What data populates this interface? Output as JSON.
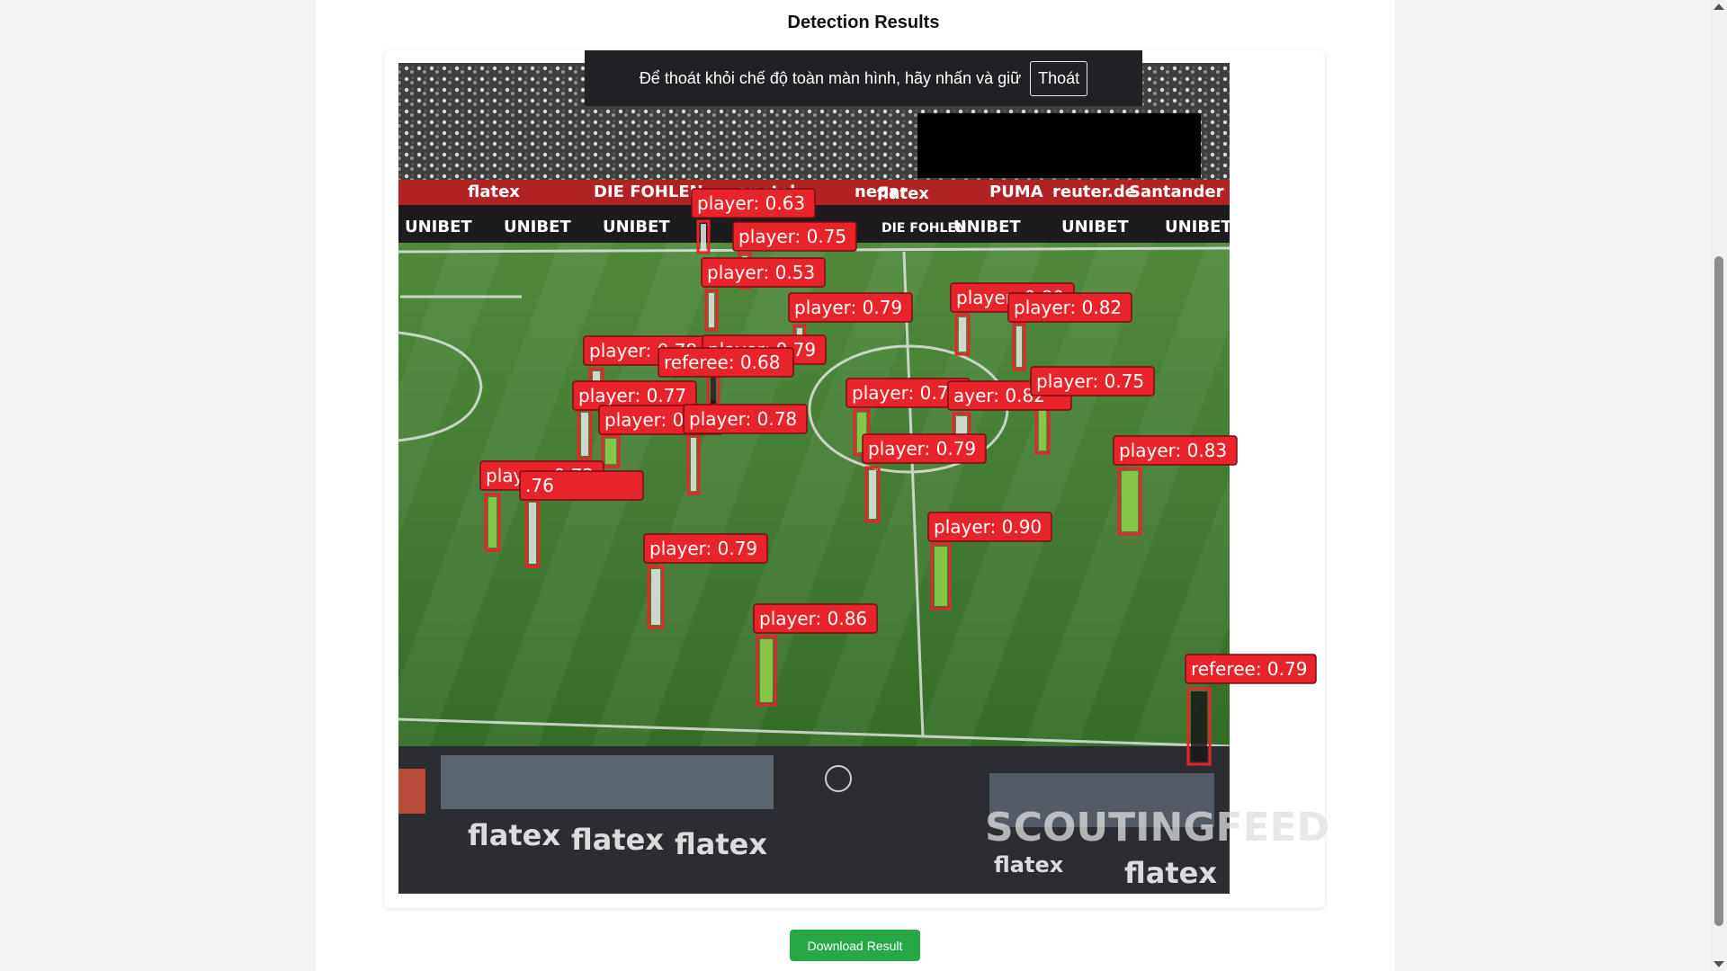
{
  "page": {
    "title": "Detection Results"
  },
  "fullscreen_banner": {
    "message": "Để thoát khỏi chế độ toàn màn hình, hãy nhấn và giữ",
    "exit_label": "Thoát"
  },
  "download_button": {
    "label": "Download Result"
  },
  "colors": {
    "detection_box": "#e8232a",
    "download_button": "#28a745",
    "banner_bg": "#202124"
  },
  "image_overlay": {
    "stadium_text": [
      "flatex",
      "UNIBET",
      "apotal",
      "PUMA",
      "reuter.de",
      "Santander",
      "DIE FOHLEN",
      "nepar"
    ],
    "watermark": "SCOUTINGFEED"
  },
  "detections": [
    {
      "label": "player: 0.63"
    },
    {
      "label": "player: 0.75"
    },
    {
      "label": "player: 0.53"
    },
    {
      "label": "player: 0.79"
    },
    {
      "label": "player: 0.80"
    },
    {
      "label": "player: 0.82"
    },
    {
      "label": "player: 0.78"
    },
    {
      "label": "player: 0.79"
    },
    {
      "label": "referee: 0.68"
    },
    {
      "label": "player: 0.77"
    },
    {
      "label": "player: 0"
    },
    {
      "label": "player: 0.78"
    },
    {
      "label": "player: 0.76"
    },
    {
      "label": "ayer: 0.82"
    },
    {
      "label": "player: 0.75"
    },
    {
      "label": "player: 0.79"
    },
    {
      "label": "player: 0.83"
    },
    {
      "label": "player: 0.72"
    },
    {
      "label": ".76"
    },
    {
      "label": "player: 0.79"
    },
    {
      "label": "player: 0.90"
    },
    {
      "label": "player: 0.86"
    },
    {
      "label": "referee: 0.79"
    }
  ]
}
